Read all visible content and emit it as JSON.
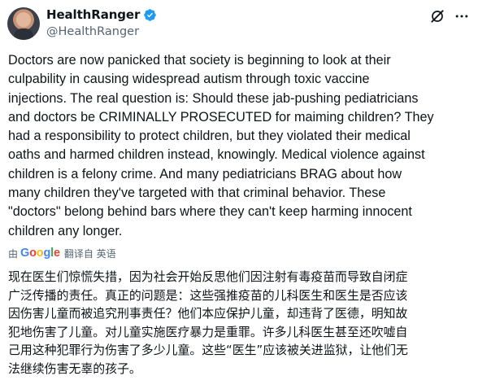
{
  "author": {
    "display_name": "HealthRanger",
    "handle": "@HealthRanger",
    "verified": true,
    "verified_color": "#1d9bf0"
  },
  "icons": [
    "avatar",
    "verified-badge-icon",
    "grok-icon",
    "more-options-icon"
  ],
  "tweet": {
    "text": "Doctors are now panicked that society is beginning to look at their\nculpability in causing widespread autism through toxic vaccine\ninjections. The real question is: Should these jab-pushing pediatricians\nand doctors be CRIMINALLY PROSECUTED for maiming children? They\nhad a responsibility to protect children, but they violated their medical\noaths and harmed children instead, knowingly. Medical violence against\nchildren is a felony crime. And many pediatricians BRAG about how\nmany children they've targeted with that criminal behavior. These\n\"doctors\" belong behind bars where they can't keep harming innocent\nchildren any longer."
  },
  "translation": {
    "by_label": "由",
    "provider_parts": [
      "G",
      "o",
      "o",
      "g",
      "l",
      "e"
    ],
    "action_label": "翻译自 英语",
    "text": "现在医生们惊慌失措，因为社会开始反思他们因注射有毒疫苗而导致自闭症\n广泛传播的责任。真正的问题是：这些强推疫苗的儿科医生和医生是否应该\n因伤害儿童而被追究刑事责任？他们本应保护儿童，却违背了医德，明知故\n犯地伤害了儿童。对儿童实施医疗暴力是重罪。许多儿科医生甚至还吹嘘自\n己用这种犯罪行为伤害了多少儿童。这些“医生”应该被关进监狱，让他们无\n法继续伤害无辜的孩子。"
  }
}
